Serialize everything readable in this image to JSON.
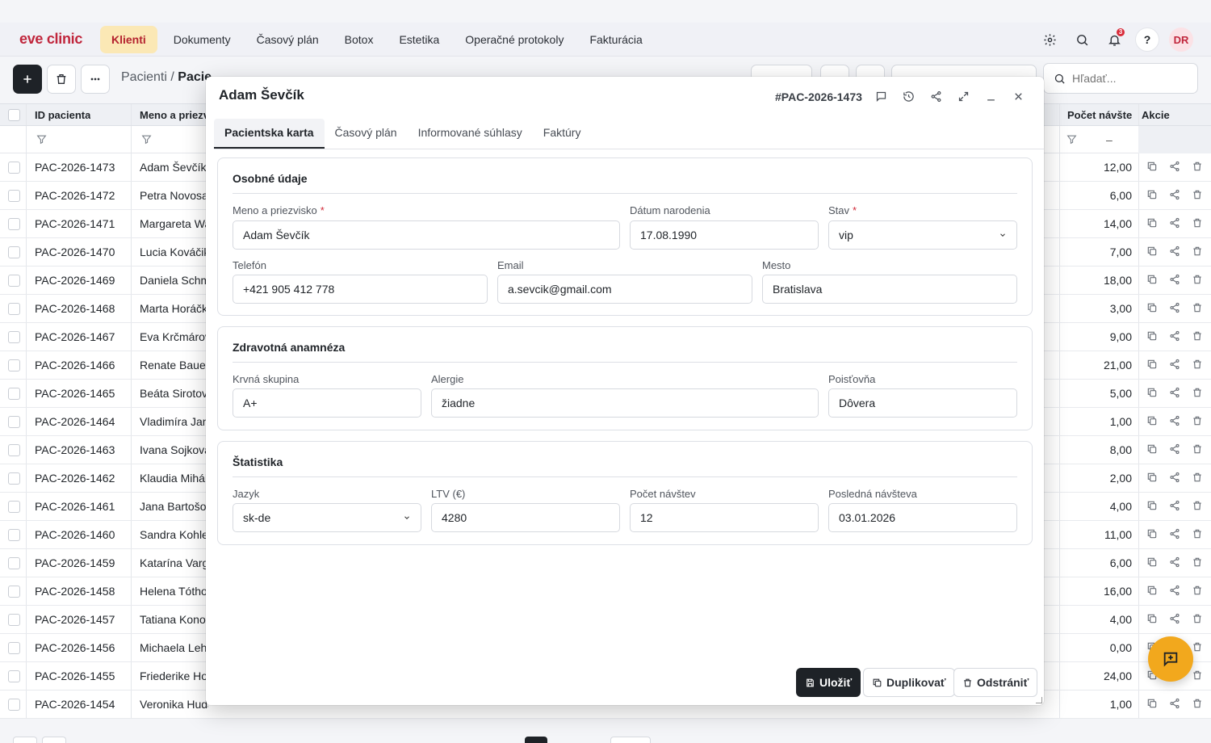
{
  "app": {
    "logo": "eve clinic"
  },
  "nav": {
    "items": [
      {
        "label": "Klienti",
        "active": true
      },
      {
        "label": "Dokumenty"
      },
      {
        "label": "Časový plán"
      },
      {
        "label": "Botox"
      },
      {
        "label": "Estetika"
      },
      {
        "label": "Operačné protokoly"
      },
      {
        "label": "Fakturácia"
      }
    ],
    "notifications": "3",
    "help": "?",
    "user_initials": "DR"
  },
  "toolbar": {
    "breadcrumb_root": "Pacienti",
    "breadcrumb_sep": " / ",
    "breadcrumb_current": "Pacie",
    "search_placeholder": "Hľadať..."
  },
  "table": {
    "columns": {
      "id": "ID pacienta",
      "name": "Meno a priezv",
      "visits": "Počet návšte",
      "actions": "Akcie"
    },
    "visits_filter": "–",
    "rows": [
      {
        "id": "PAC-2026-1473",
        "name": "Adam Ševčík",
        "visits": "12,00"
      },
      {
        "id": "PAC-2026-1472",
        "name": "Petra Novosa",
        "visits": "6,00"
      },
      {
        "id": "PAC-2026-1471",
        "name": "Margareta Wa",
        "visits": "14,00"
      },
      {
        "id": "PAC-2026-1470",
        "name": "Lucia Kováčik",
        "visits": "7,00"
      },
      {
        "id": "PAC-2026-1469",
        "name": "Daniela Schm",
        "visits": "18,00"
      },
      {
        "id": "PAC-2026-1468",
        "name": "Marta Horáčk",
        "visits": "3,00"
      },
      {
        "id": "PAC-2026-1467",
        "name": "Eva Krčmárov",
        "visits": "9,00"
      },
      {
        "id": "PAC-2026-1466",
        "name": "Renate Bauer",
        "visits": "21,00"
      },
      {
        "id": "PAC-2026-1465",
        "name": "Beáta Sirotov",
        "visits": "5,00"
      },
      {
        "id": "PAC-2026-1464",
        "name": "Vladimíra Jan",
        "visits": "1,00"
      },
      {
        "id": "PAC-2026-1463",
        "name": "Ivana Sojkova",
        "visits": "8,00"
      },
      {
        "id": "PAC-2026-1462",
        "name": "Klaudia Mihál",
        "visits": "2,00"
      },
      {
        "id": "PAC-2026-1461",
        "name": "Jana Bartošo",
        "visits": "4,00"
      },
      {
        "id": "PAC-2026-1460",
        "name": "Sandra Kohle",
        "visits": "11,00"
      },
      {
        "id": "PAC-2026-1459",
        "name": "Katarína Varg",
        "visits": "6,00"
      },
      {
        "id": "PAC-2026-1458",
        "name": "Helena Tótho",
        "visits": "16,00"
      },
      {
        "id": "PAC-2026-1457",
        "name": "Tatiana Konop",
        "visits": "4,00"
      },
      {
        "id": "PAC-2026-1456",
        "name": "Michaela Leh",
        "visits": "0,00"
      },
      {
        "id": "PAC-2026-1455",
        "name": "Friederike Ho",
        "visits": "24,00"
      },
      {
        "id": "PAC-2026-1454",
        "name": "Veronika Hudáková",
        "visits": "1,00"
      }
    ]
  },
  "modal": {
    "title": "Adam Ševčík",
    "record_id": "#PAC-2026-1473",
    "tabs": [
      "Pacientska karta",
      "Časový plán",
      "Informované súhlasy",
      "Faktúry"
    ],
    "personal": {
      "title": "Osobné údaje",
      "name_label": "Meno a priezvisko",
      "name_value": "Adam Ševčík",
      "dob_label": "Dátum narodenia",
      "dob_value": "17.08.1990",
      "status_label": "Stav",
      "status_value": "vip",
      "phone_label": "Telefón",
      "phone_value": "+421 905 412 778",
      "email_label": "Email",
      "email_value": "a.sevcik@gmail.com",
      "city_label": "Mesto",
      "city_value": "Bratislava",
      "required_mark": "*"
    },
    "health": {
      "title": "Zdravotná anamnéza",
      "blood_label": "Krvná skupina",
      "blood_value": "A+",
      "allergy_label": "Alergie",
      "allergy_value": "žiadne",
      "insurance_label": "Poisťovňa",
      "insurance_value": "Dôvera"
    },
    "stats": {
      "title": "Štatistika",
      "lang_label": "Jazyk",
      "lang_value": "sk-de",
      "ltv_label": "LTV (€)",
      "ltv_value": "4280",
      "visits_label": "Počet návštev",
      "visits_value": "12",
      "last_label": "Posledná návšteva",
      "last_value": "03.01.2026"
    },
    "buttons": {
      "save": "Uložiť",
      "duplicate": "Duplikovať",
      "delete": "Odstrániť"
    }
  }
}
